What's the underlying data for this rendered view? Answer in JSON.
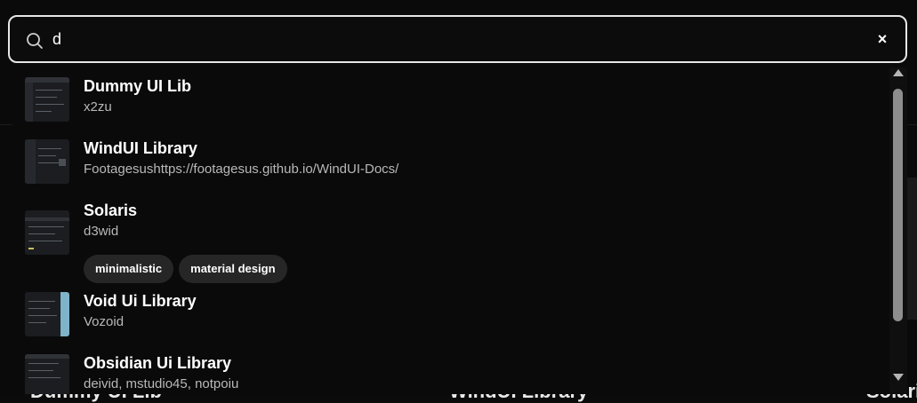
{
  "search": {
    "value": "d",
    "clear_label": "×"
  },
  "results": [
    {
      "title": "Dummy UI Lib",
      "subtitle": "x2zu",
      "tags": []
    },
    {
      "title": "WindUI Library",
      "subtitle": "Footagesushttps://footagesus.github.io/WindUI-Docs/",
      "tags": []
    },
    {
      "title": "Solaris",
      "subtitle": "d3wid",
      "tags": [
        "minimalistic",
        "material design"
      ]
    },
    {
      "title": "Void Ui Library",
      "subtitle": "Vozoid",
      "tags": []
    },
    {
      "title": "Obsidian Ui Library",
      "subtitle": "deivid, mstudio45, notpoiu",
      "tags": []
    }
  ],
  "background": {
    "card_titles": [
      "Dummy UI Lib",
      "WindUI Library",
      "Solari"
    ]
  },
  "colors": {
    "background": "#0b0b0b",
    "search_border": "#e7e7e7",
    "tag_background": "#262626",
    "scroll_thumb": "#8e8e8e"
  }
}
